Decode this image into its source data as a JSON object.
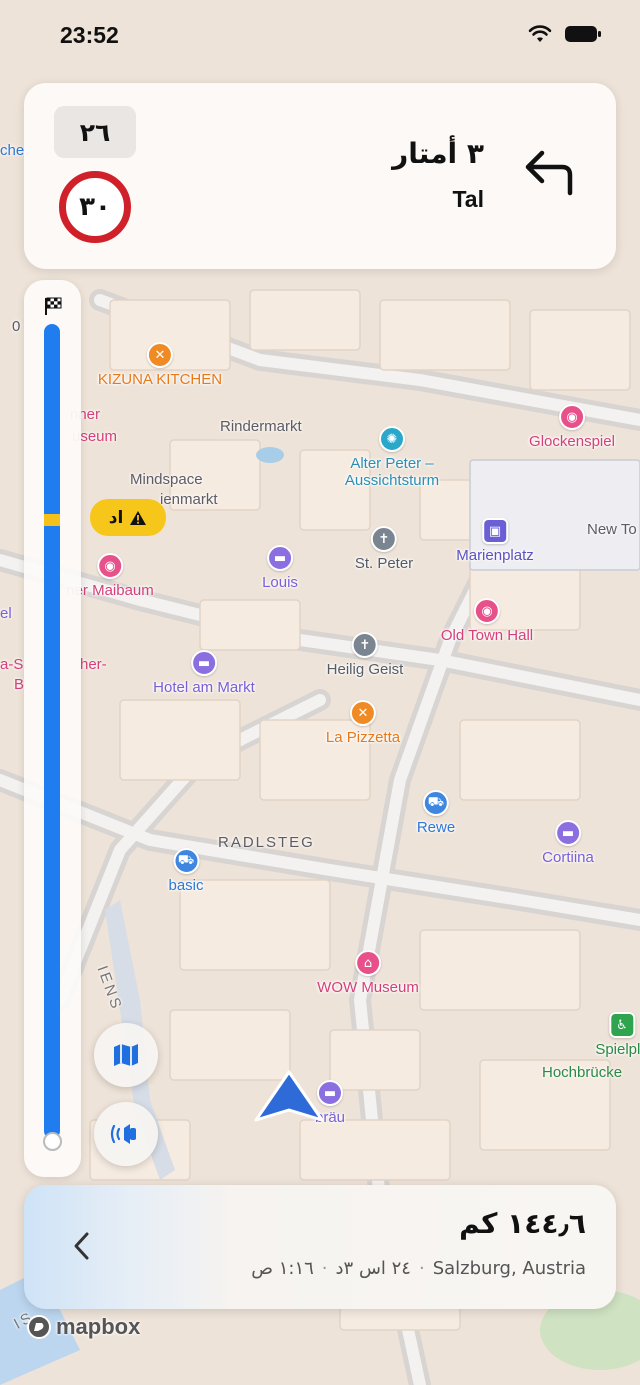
{
  "status": {
    "time": "23:52"
  },
  "instruction": {
    "current_speed": "٢٦",
    "speed_limit": "٣٠",
    "distance": "٣ أمتار",
    "street": "Tal",
    "maneuver_icon": "turn-left-arrow-icon"
  },
  "alert": {
    "text": "اد",
    "icon": "warning-icon"
  },
  "map": {
    "pois": [
      {
        "name": "KIZUNA KITCHEN",
        "type": "restaurant",
        "color": "#f08a24"
      },
      {
        "name": "Alter Peter – Aussichtsturm",
        "type": "viewpoint",
        "color": "#2aa7c9"
      },
      {
        "name": "Glockenspiel",
        "type": "attraction",
        "color": "#e8508a"
      },
      {
        "name": "St. Peter",
        "type": "church",
        "color": "#7a8591"
      },
      {
        "name": "Marienplatz",
        "type": "transit",
        "color": "#6b5fd6"
      },
      {
        "name": "Louis",
        "type": "hotel",
        "color": "#8b6fe0"
      },
      {
        "name": "Old Town Hall",
        "type": "attraction",
        "color": "#e8508a"
      },
      {
        "name": "Heilig Geist",
        "type": "church",
        "color": "#7a8591"
      },
      {
        "name": "Hotel am Markt",
        "type": "hotel",
        "color": "#8b6fe0"
      },
      {
        "name": "La Pizzetta",
        "type": "restaurant",
        "color": "#f08a24"
      },
      {
        "name": "Rewe",
        "type": "shop",
        "color": "#3e86e0"
      },
      {
        "name": "Cortiina",
        "type": "hotel",
        "color": "#8b6fe0"
      },
      {
        "name": "basic",
        "type": "shop",
        "color": "#3e86e0"
      },
      {
        "name": "WOW Museum",
        "type": "museum",
        "color": "#e8508a"
      },
      {
        "name": "Spielpla",
        "type": "playground",
        "color": "#2ea44f"
      },
      {
        "name": "Hochbrücke",
        "type": "label",
        "color": "#2ea44f"
      },
      {
        "name": "bräu",
        "type": "hotel",
        "color": "#8b6fe0"
      },
      {
        "name": "ner Maibaum",
        "type": "attraction",
        "color": "#e8508a"
      },
      {
        "name": "nner",
        "type": "attraction",
        "color": "#e8508a"
      },
      {
        "name": "useum",
        "type": "attraction",
        "color": "#e8508a"
      },
      {
        "name": "New To",
        "type": "label",
        "color": "#5d5b64"
      }
    ],
    "labels": {
      "rindermarkt": "Rindermarkt",
      "mindspace": "Mindspace",
      "mindspace2": "ienmarkt",
      "radlsteg": "RADLSTEG",
      "che": "che",
      "os": "0",
      "el": "el",
      "ser": "a-S",
      "her": "her-",
      "b": "B",
      "iens": "IENS",
      "is": "IS"
    }
  },
  "buttons": {
    "map_icon": "map-icon",
    "sound_icon": "speaker-icon"
  },
  "trip": {
    "remaining_distance": "١٤٤٫٦ كم",
    "destination": "Salzburg, Austria",
    "duration": "٢٤ اس ٣د",
    "arrival": "١:١٦ ص",
    "separator": "·"
  },
  "attribution": {
    "logo_text": "mapbox"
  },
  "colors": {
    "route_blue": "#1f7df0",
    "alert_yellow": "#f7c61b",
    "limit_red": "#d0202a"
  }
}
